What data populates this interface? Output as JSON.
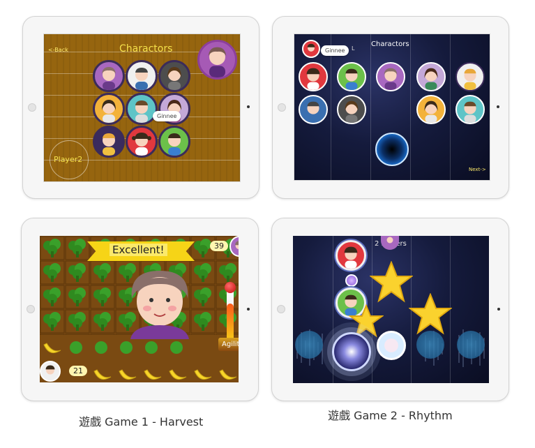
{
  "colors": {
    "wood": "#96650f",
    "title_yellow": "#f4e04a",
    "space": "#151b3d",
    "grass": "#7a4a12",
    "banner": "#f6d417"
  },
  "game1_characters": {
    "title": "Charactors",
    "back_label": "<-Back",
    "player_label": "Player2",
    "bubble": "Ginnee"
  },
  "game2_characters": {
    "title": "Charactors",
    "bubble": "Ginnee",
    "letter": "L",
    "next_label": "Next->"
  },
  "game1_play": {
    "banner": "Excellent!",
    "score_top": "39",
    "score_bottom": "21",
    "agility_label": "Agility",
    "agility_level": 0.7
  },
  "game2_play": {
    "players_label": "2 Players"
  },
  "captions": {
    "game1": "遊戲 Game 1 - Harvest",
    "game2": "遊戲 Game 2 - Rhythm"
  }
}
